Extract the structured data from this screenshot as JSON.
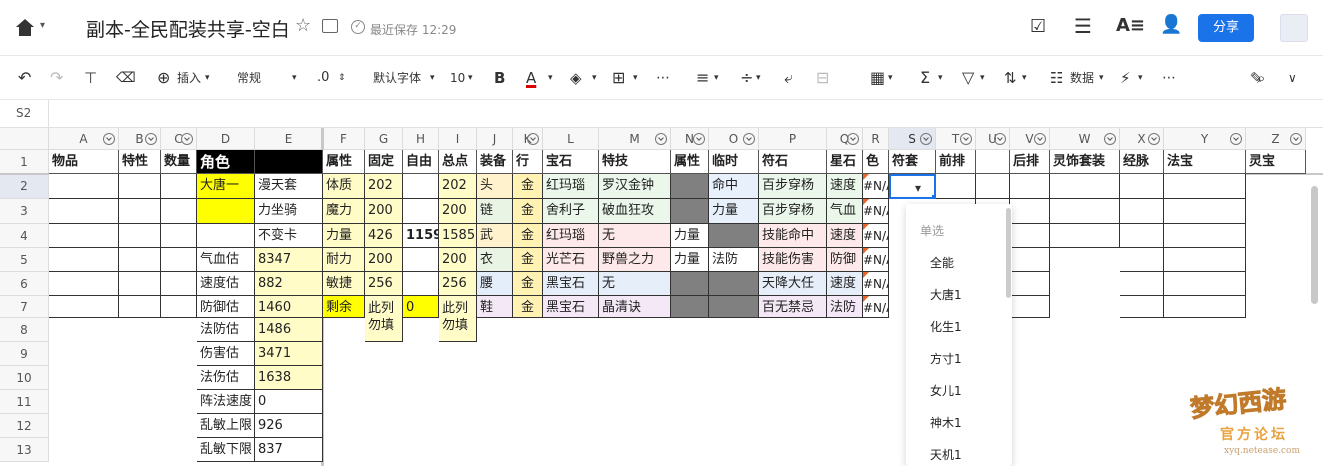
{
  "header": {
    "title": "副本-全民配装共享-空白",
    "save_status": "最近保存 12:29",
    "share_label": "分享"
  },
  "toolbar": {
    "insert": "插入",
    "format": "常规",
    "decimals": ".0",
    "font": "默认字体",
    "font_size": "10",
    "data": "数据"
  },
  "formula_bar": {
    "cell_ref": "S2"
  },
  "columns": [
    "A",
    "B",
    "C",
    "D",
    "E",
    "F",
    "G",
    "H",
    "I",
    "J",
    "K",
    "L",
    "M",
    "N",
    "O",
    "P",
    "Q",
    "R",
    "S",
    "T",
    "U",
    "V",
    "W",
    "X",
    "Y",
    "Z"
  ],
  "rows": [
    "1",
    "2",
    "3",
    "4",
    "5",
    "6",
    "7",
    "8",
    "9",
    "10",
    "11",
    "12",
    "13"
  ],
  "header_row": [
    "物品",
    "特性",
    "数量",
    "角色",
    "",
    "属性",
    "固定",
    "自由",
    "总点",
    "装备",
    "行",
    "宝石",
    "特技",
    "属性",
    "临时",
    "符石",
    "星石",
    "色",
    "符套",
    "前排",
    "",
    "后排",
    "灵饰套装",
    "经脉",
    "法宝",
    "灵宝"
  ],
  "cells": {
    "D2": "大唐一",
    "E2": "漫天套",
    "E3": "力坐骑",
    "E4": "不变卡",
    "D5": "气血估",
    "E5": "8347",
    "D6": "速度估",
    "E6": "882",
    "D7": "防御估",
    "E7": "1460",
    "D8": "法防估",
    "E8": "1486",
    "D9": "伤害估",
    "E9": "3471",
    "D10": "法伤估",
    "E10": "1638",
    "D11": "阵法速度",
    "E11": "0",
    "D12": "乱敏上限",
    "E12": "926",
    "D13": "乱敏下限",
    "E13": "837",
    "F2": "体质",
    "F3": "魔力",
    "F4": "力量",
    "F5": "耐力",
    "F6": "敏捷",
    "F7": "剩余",
    "G2": "202",
    "G3": "200",
    "G4": "426",
    "G5": "200",
    "G6": "256",
    "G7": "此列\n勿填",
    "H4": "1159",
    "H7": "0",
    "I2": "202",
    "I3": "200",
    "I4": "1585",
    "I5": "200",
    "I6": "256",
    "I7": "此列\n勿填",
    "J2": "头",
    "J3": "链",
    "J4": "武",
    "J5": "衣",
    "J6": "腰",
    "J7": "鞋",
    "K2": "金",
    "K3": "金",
    "K4": "金",
    "K5": "金",
    "K6": "金",
    "K7": "金",
    "L2": "红玛瑙",
    "L3": "舍利子",
    "L4": "红玛瑙",
    "L5": "光芒石",
    "L6": "黑宝石",
    "L7": "黑宝石",
    "M2": "罗汉金钟",
    "M3": "破血狂攻",
    "M4": "无",
    "M5": "野兽之力",
    "M6": "无",
    "M7": "晶清诀",
    "N4": "力量",
    "N5": "力量",
    "O2": "命中",
    "O3": "力量",
    "O5": "法防",
    "P2": "百步穿杨",
    "P3": "百步穿杨",
    "P4": "技能命中",
    "P5": "技能伤害",
    "P6": "天降大任",
    "P7": "百无禁忌",
    "Q2": "速度",
    "Q3": "气血",
    "Q4": "速度",
    "Q5": "防御",
    "Q6": "速度",
    "Q7": "法防",
    "R2": "#N/A",
    "R3": "#N/A",
    "R4": "#N/A",
    "R5": "#N/A",
    "R6": "#N/A",
    "R7": "#N/A"
  },
  "dropdown": {
    "title": "单选",
    "options": [
      "全能",
      "大唐1",
      "化生1",
      "方寸1",
      "女儿1",
      "神木1",
      "天机1"
    ]
  },
  "watermark": {
    "line1": "梦幻西游",
    "line2": "官方论坛",
    "url": "xyq.netease.com"
  },
  "colors": {
    "accent": "#1a73e8",
    "yellow": "#ffff00",
    "lightyellow": "#ffffcc",
    "black_header": "#000000",
    "gray": "#808080"
  }
}
